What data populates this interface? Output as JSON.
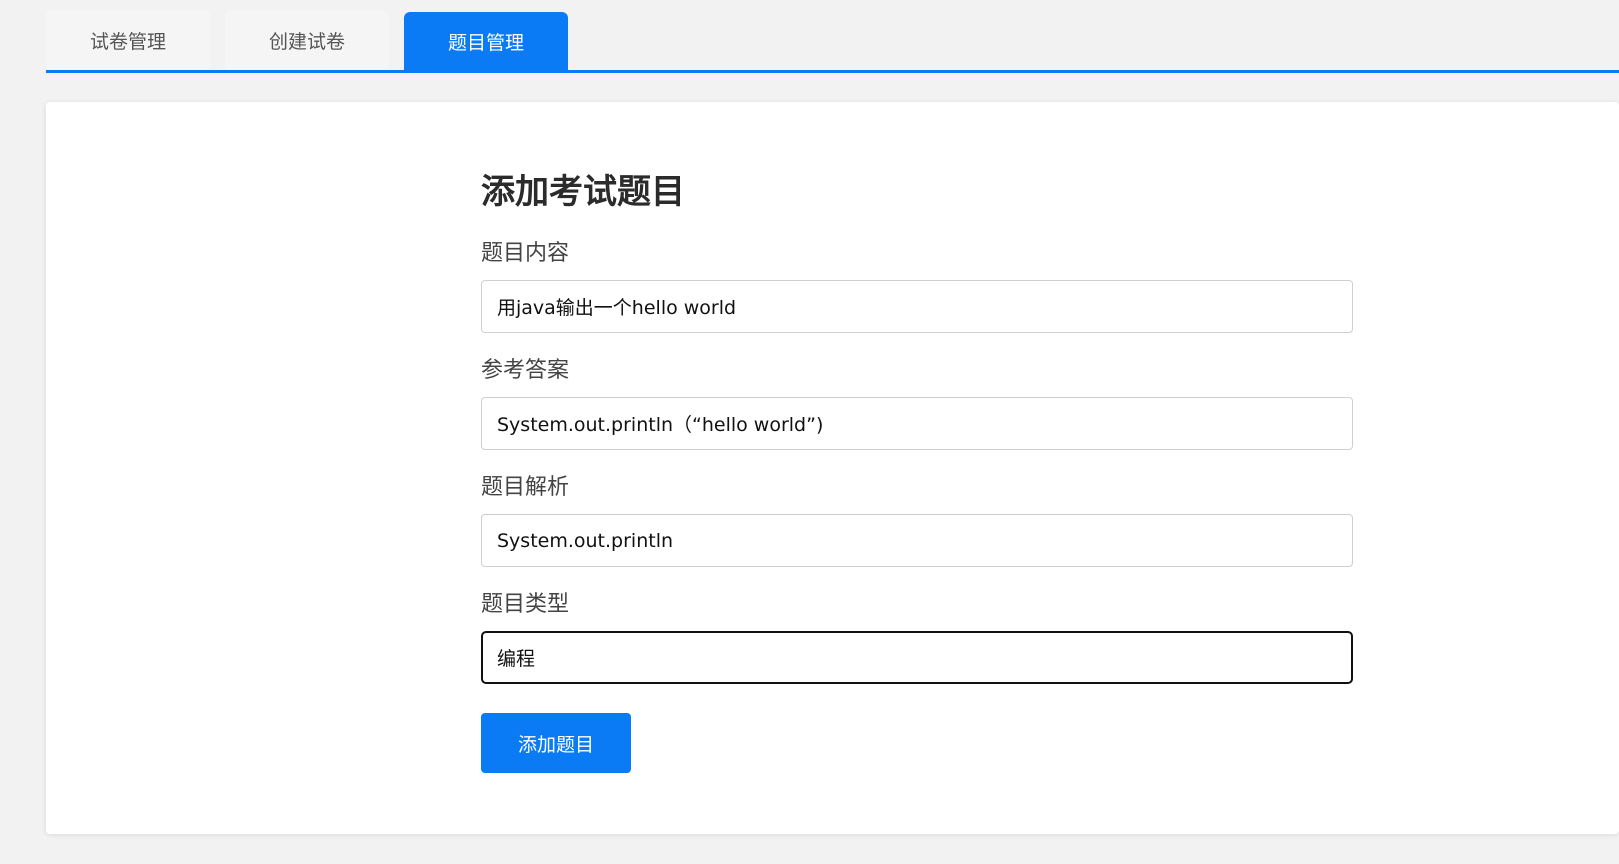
{
  "tabs": [
    {
      "label": "试卷管理",
      "active": false
    },
    {
      "label": "创建试卷",
      "active": false
    },
    {
      "label": "题目管理",
      "active": true
    }
  ],
  "form": {
    "title": "添加考试题目",
    "fields": [
      {
        "label": "题目内容",
        "value": "用java输出一个hello world"
      },
      {
        "label": "参考答案",
        "value": "System.out.println（“hello world”)"
      },
      {
        "label": "题目解析",
        "value": "System.out.println"
      },
      {
        "label": "题目类型",
        "value": "编程"
      }
    ],
    "submit_label": "添加题目"
  },
  "colors": {
    "accent": "#0a7bf4",
    "background": "#f2f2f2",
    "panel": "#ffffff"
  }
}
